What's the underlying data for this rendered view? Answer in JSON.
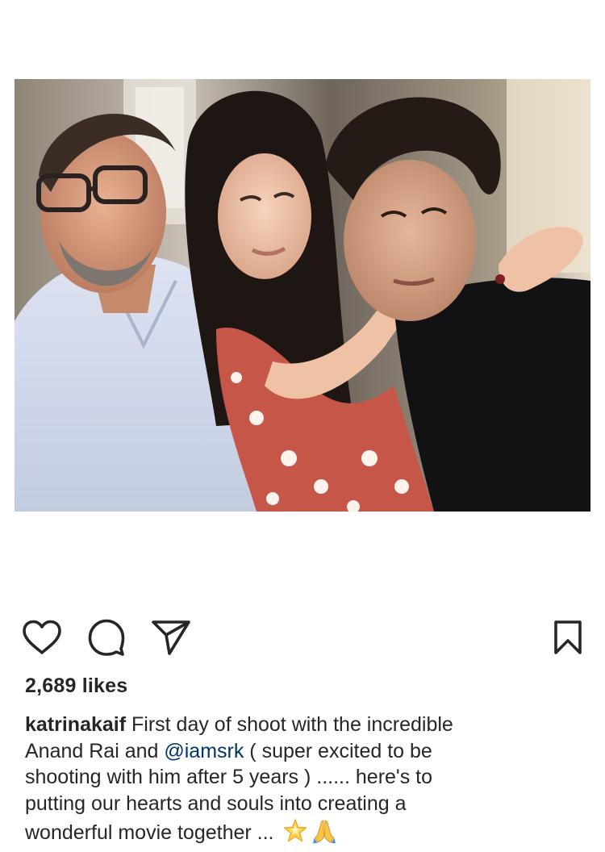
{
  "post": {
    "photo_icon": "photo-image",
    "actions": {
      "like_icon": "heart-icon",
      "comment_icon": "comment-icon",
      "share_icon": "paper-plane-icon",
      "save_icon": "bookmark-icon"
    },
    "likes_text": "2,689 likes",
    "caption": {
      "username": "katrinakaif",
      "line1_text": " First day of shoot with the incredible",
      "line2_prefix": "Anand Rai and ",
      "mention": "@iamsrk",
      "line2_suffix": " ( super excited to be",
      "line3": "shooting with him after 5 years ) ...... here's to",
      "line4": "putting our hearts and souls into creating a",
      "line5": "wonderful movie together ... ",
      "emojis": [
        "glowing-star-icon",
        "folded-hands-icon"
      ]
    },
    "colors": {
      "text": "#262626",
      "mention": "#003569",
      "background": "#ffffff"
    }
  }
}
